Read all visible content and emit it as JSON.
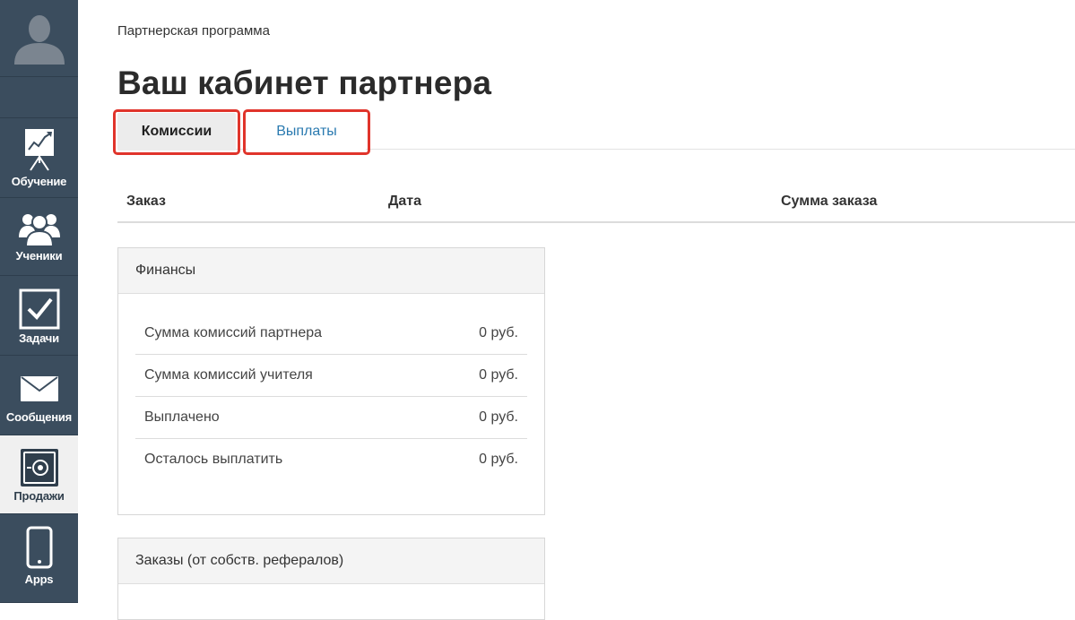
{
  "sidebar": {
    "items": [
      {
        "label": "Обучение",
        "icon": "chart-board-icon"
      },
      {
        "label": "Ученики",
        "icon": "users-icon"
      },
      {
        "label": "Задачи",
        "icon": "checkbox-icon"
      },
      {
        "label": "Сообщения",
        "icon": "envelope-icon"
      },
      {
        "label": "Продажи",
        "icon": "safe-icon",
        "active": true
      },
      {
        "label": "Apps",
        "icon": "smartphone-icon"
      }
    ]
  },
  "breadcrumb": "Партнерская программа",
  "page_title": "Ваш кабинет партнера",
  "tabs": [
    {
      "label": "Комиссии",
      "active": true
    },
    {
      "label": "Выплаты",
      "active": false
    }
  ],
  "table": {
    "columns": [
      "Заказ",
      "Дата",
      "Сумма заказа"
    ]
  },
  "finance_panel": {
    "title": "Финансы",
    "rows": [
      {
        "label": "Сумма комиссий партнера",
        "value": "0 руб."
      },
      {
        "label": "Сумма комиссий учителя",
        "value": "0 руб."
      },
      {
        "label": "Выплачено",
        "value": "0 руб."
      },
      {
        "label": "Осталось выплатить",
        "value": "0 руб."
      }
    ]
  },
  "orders_panel": {
    "title": "Заказы (от собств. рефералов)"
  },
  "colors": {
    "sidebar": "#3b4d5e",
    "highlight": "#e0342b",
    "link": "#2a7ab0"
  }
}
